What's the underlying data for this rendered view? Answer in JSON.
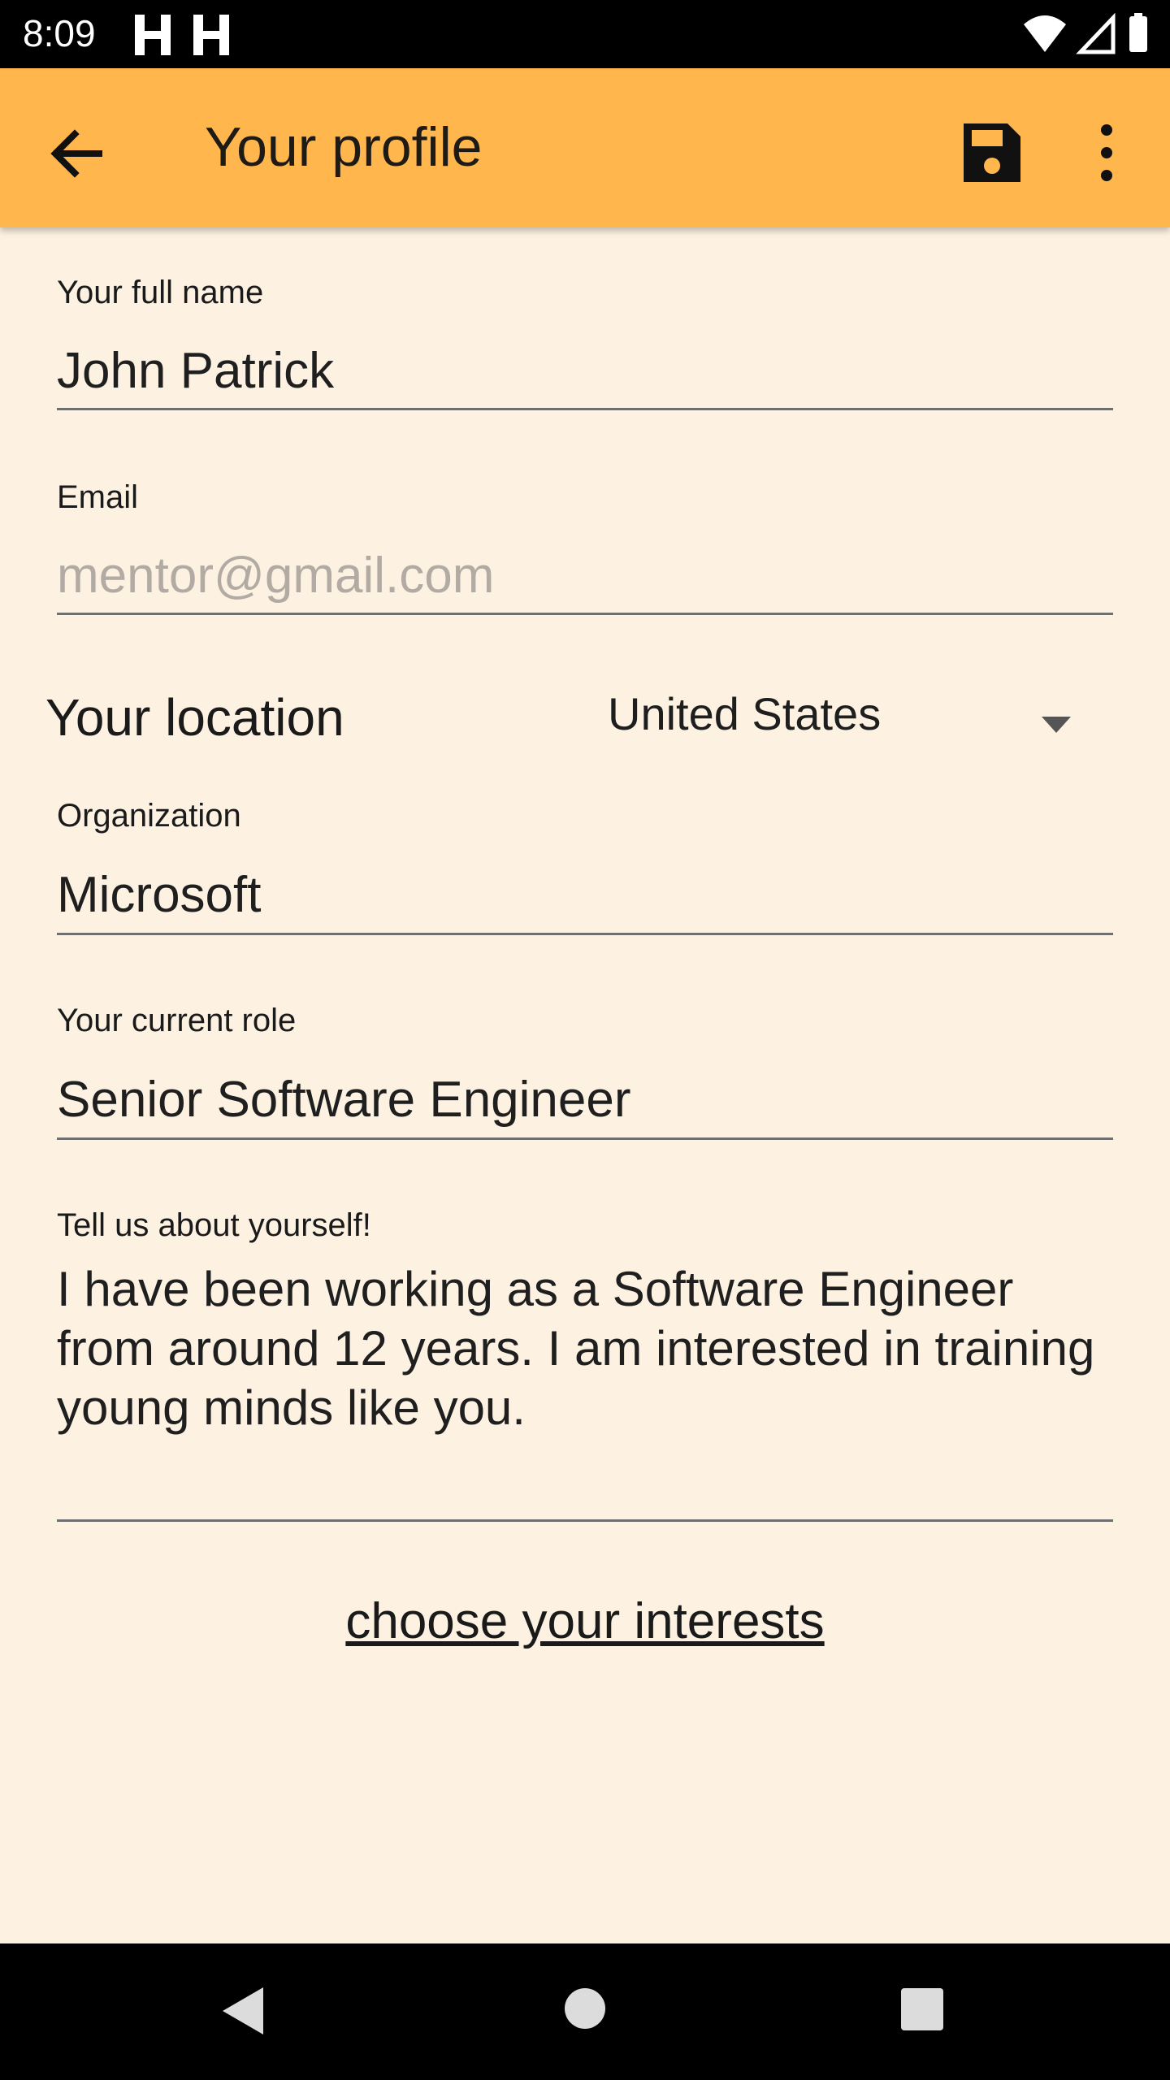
{
  "status_bar": {
    "time": "8:09"
  },
  "app_bar": {
    "title": "Your profile"
  },
  "form": {
    "full_name": {
      "label": "Your full name",
      "value": "John Patrick"
    },
    "email": {
      "label": "Email",
      "placeholder": "mentor@gmail.com"
    },
    "location": {
      "label": "Your location",
      "selected": "United States"
    },
    "organization": {
      "label": "Organization",
      "value": "Microsoft"
    },
    "role": {
      "label": "Your current role",
      "value": "Senior Software Engineer"
    },
    "bio": {
      "label": "Tell us about yourself!",
      "value": "I have been working as a Software Engineer from around 12 years. I am interested in training young minds like you."
    },
    "interests_link": "choose your interests"
  },
  "colors": {
    "app_bar": "#ffb74d",
    "background": "#fdf1e1"
  }
}
